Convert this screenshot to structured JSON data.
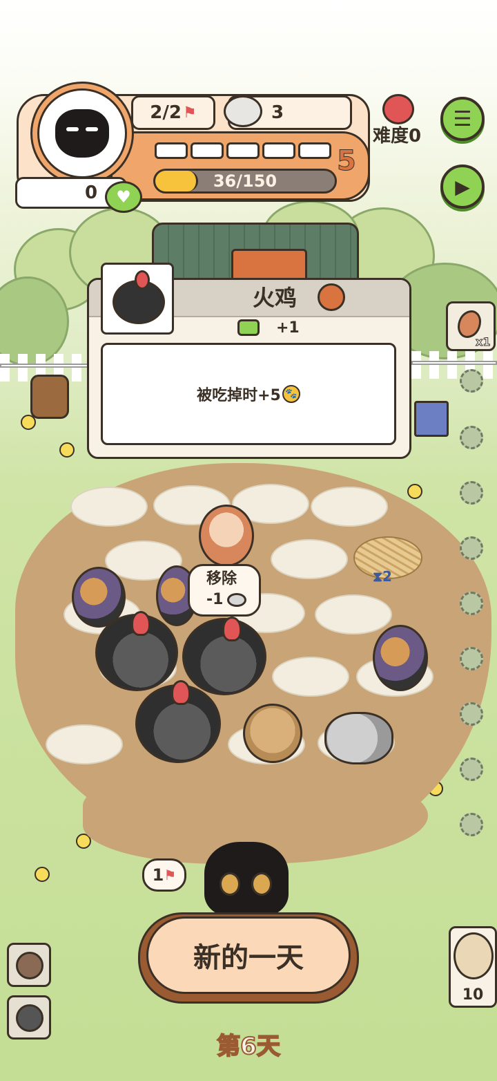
{
  "hud": {
    "flags": "2/2",
    "food_cans": "3",
    "hearts": "0",
    "xp_text": "36/150",
    "xp_fraction": 0.24,
    "level": "5",
    "level_segments_filled": 0,
    "level_segments_total": 5,
    "difficulty": "难度0",
    "menu_icon": "menu-icon",
    "play_icon": "play-icon"
  },
  "card": {
    "name": "火鸡",
    "food_bonus": "+1",
    "description": "被吃掉时+5",
    "portrait_icon": "turkey-icon"
  },
  "board": {
    "remove_label": "移除",
    "remove_cost": "-1",
    "nest_timer": "2"
  },
  "side": {
    "feather_count": "x1",
    "owl_count": "10"
  },
  "bottom": {
    "flags_count": "1",
    "new_day_label": "新的一天",
    "day_label": "第6天"
  },
  "colors": {
    "accent_orange": "#f0a66b",
    "level_color": "#d9733f",
    "green_button": "#8fd254",
    "xp_fill": "#f7c33c"
  }
}
